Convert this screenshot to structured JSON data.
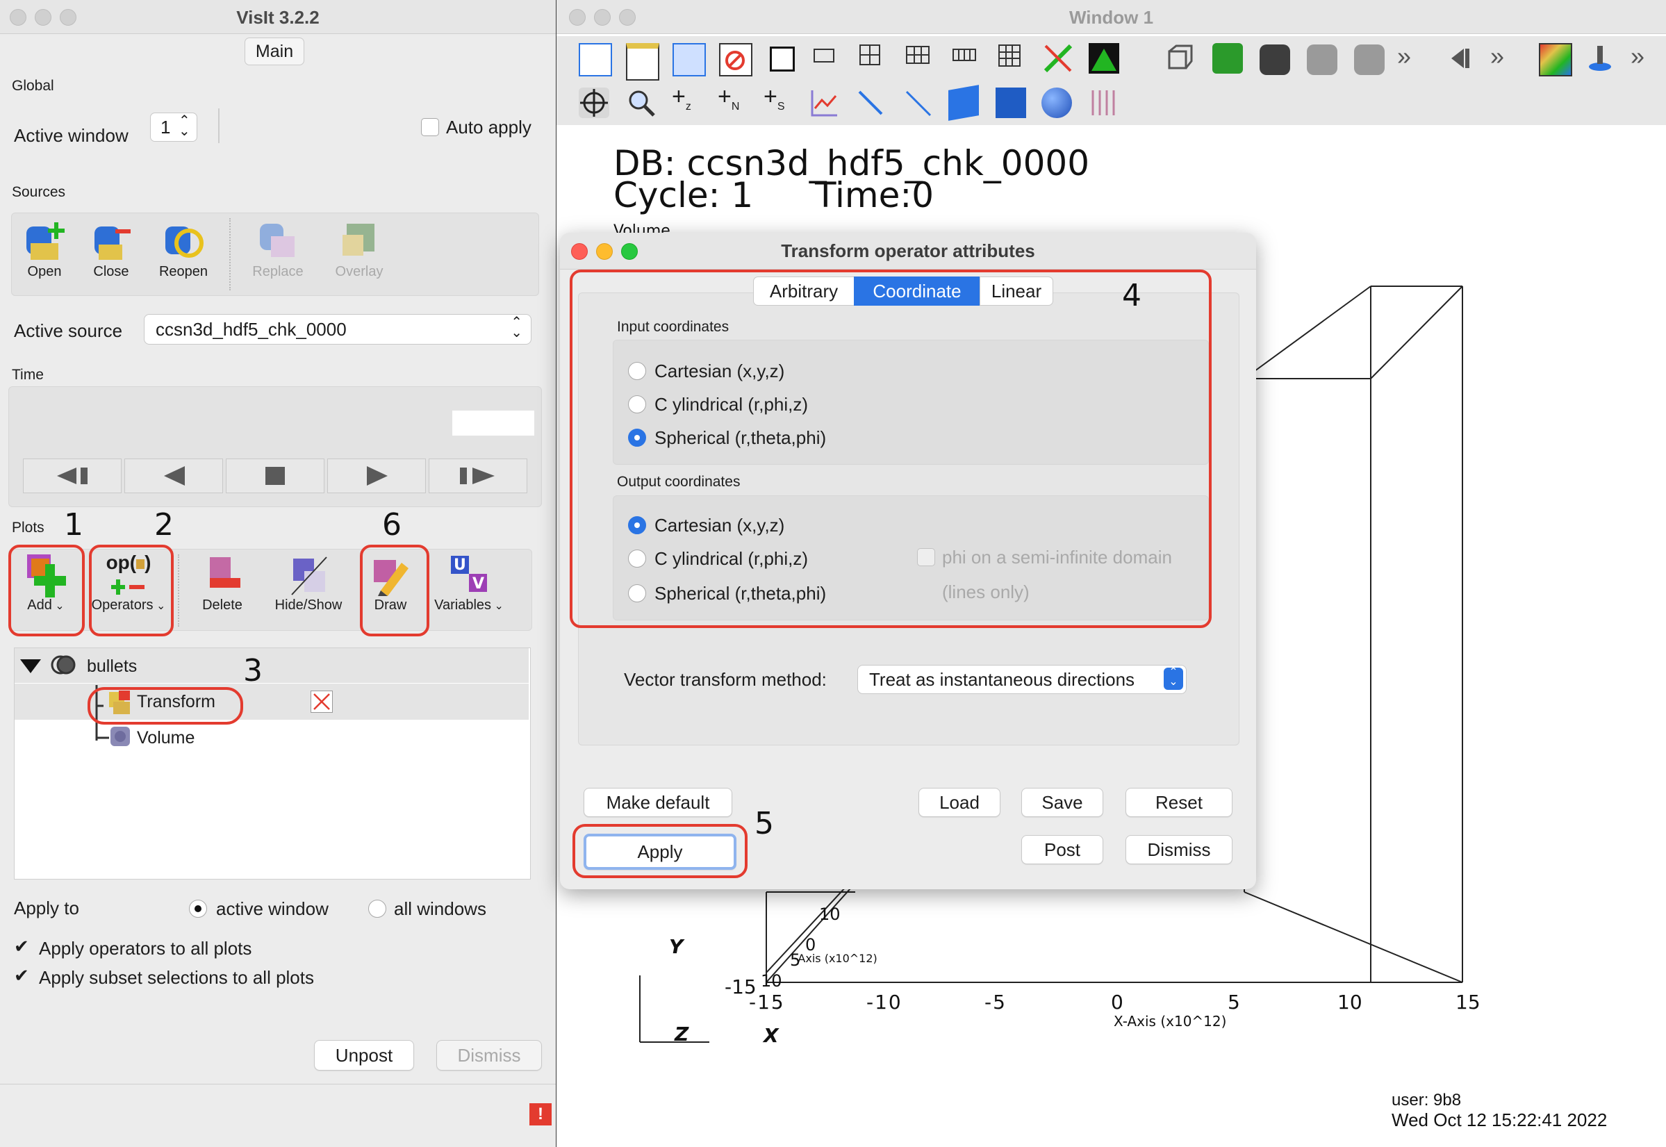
{
  "main_window": {
    "title": "VisIt 3.2.2",
    "tab": "Main",
    "global_label": "Global",
    "active_window_label": "Active window",
    "active_window_value": "1",
    "auto_apply_label": "Auto apply",
    "sources_label": "Sources",
    "source_buttons": [
      "Open",
      "Close",
      "Reopen",
      "Replace",
      "Overlay"
    ],
    "active_source_label": "Active source",
    "active_source_value": "ccsn3d_hdf5_chk_0000",
    "time_label": "Time",
    "plots_label": "Plots",
    "plot_buttons": [
      "Add",
      "Operators",
      "Delete",
      "Hide/Show",
      "Draw",
      "Variables"
    ],
    "operators_icon_text": "op(",
    "plot_list": {
      "root": "bullets",
      "children": [
        "Transform",
        "Volume"
      ]
    },
    "apply_to_label": "Apply to",
    "apply_to_options": [
      "active window",
      "all windows"
    ],
    "apply_operators_label": "Apply operators to all plots",
    "apply_subset_label": "Apply subset selections to all plots",
    "unpost_label": "Unpost",
    "dismiss_label": "Dismiss"
  },
  "annotations": {
    "n1": "1",
    "n2": "2",
    "n3": "3",
    "n4": "4",
    "n5": "5",
    "n6": "6"
  },
  "viz_window": {
    "title": "Window 1",
    "db_line": "DB: ccsn3d_hdf5_chk_0000",
    "cycle_line": "Cycle: 1",
    "time_line": "Time:0",
    "plot_label_partial": "Volume",
    "x_ticks": [
      "-15",
      "-10",
      "-5",
      "0",
      "5",
      "10",
      "15"
    ],
    "x_axis_title": "X-Axis (x10^12)",
    "y_axis_title_partial": "-Axis (x10^12)",
    "y_ticks_partial": [
      "10",
      "0",
      "5"
    ],
    "y_label": "Y",
    "z_label": "Z",
    "x_label": "X",
    "y_neg_tick": "-15",
    "y_neg_tick2": "10",
    "user_line": "user: 9b8",
    "date_line": "Wed Oct 12 15:22:41 2022"
  },
  "dialog": {
    "title": "Transform operator attributes",
    "tabs": [
      "Arbitrary",
      "Coordinate",
      "Linear"
    ],
    "active_tab": "Coordinate",
    "input_label": "Input coordinates",
    "input_options": [
      "Cartesian (x,y,z)",
      "C ylindrical (r,phi,z)",
      "Spherical (r,theta,phi)"
    ],
    "input_selected": "Spherical (r,theta,phi)",
    "output_label": "Output coordinates",
    "output_options": [
      "Cartesian (x,y,z)",
      "C ylindrical (r,phi,z)",
      "Spherical (r,theta,phi)"
    ],
    "output_selected": "Cartesian (x,y,z)",
    "phi_option_line1": "phi on a semi-infinite domain",
    "phi_option_line2": "(lines only)",
    "vector_label": "Vector transform method:",
    "vector_value": "Treat as instantaneous directions",
    "buttons": {
      "make_default": "Make default",
      "load": "Load",
      "save": "Save",
      "reset": "Reset",
      "apply": "Apply",
      "post": "Post",
      "dismiss": "Dismiss"
    }
  },
  "colors": {
    "accent": "#2a74e4",
    "annotation_red": "#e33b2f"
  }
}
